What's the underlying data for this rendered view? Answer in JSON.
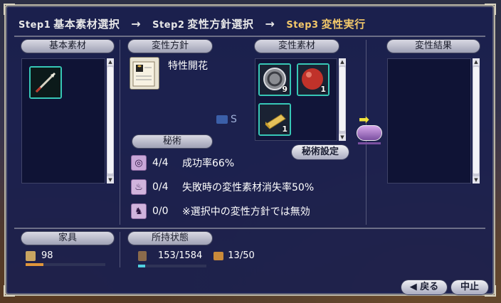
{
  "steps": {
    "step1": {
      "num": "Step1",
      "label": "基本素材選択"
    },
    "step2": {
      "num": "Step2",
      "label": "変性方針選択"
    },
    "step3": {
      "num": "Step3",
      "label": "変性実行"
    },
    "arrow": "→"
  },
  "panels": {
    "base_material": {
      "title": "基本素材"
    },
    "policy": {
      "title": "変性方針",
      "name": "特性開花"
    },
    "materials": {
      "title": "変性素材",
      "items": [
        {
          "icon": "coin-icon",
          "count": "9"
        },
        {
          "icon": "red-ball-icon",
          "count": "1"
        },
        {
          "icon": "gold-ingot-icon",
          "count": "1"
        }
      ]
    },
    "result": {
      "title": "変性結果"
    },
    "secret": {
      "title": "秘術",
      "button": "秘術設定",
      "rows": [
        {
          "icon": "swirl-icon",
          "count": "4/4",
          "desc": "成功率66%"
        },
        {
          "icon": "flame-icon",
          "count": "0/4",
          "desc": "失敗時の変性素材消失率50%"
        },
        {
          "icon": "horse-icon",
          "count": "0/0",
          "desc": "※選択中の変性方針では無効"
        }
      ]
    },
    "furniture": {
      "title": "家具",
      "value": "98",
      "fill": 0.22
    },
    "status": {
      "title": "所持状態",
      "weight": "153/1584",
      "slots": "13/50",
      "fill": 0.1
    }
  },
  "buttons": {
    "back": "戻る",
    "stop": "中止"
  },
  "hud_fragment": "S",
  "colors": {
    "active_step": "#f3c86a",
    "slot_border": "#37c7b6",
    "window_bg": "#1a1f4e"
  }
}
